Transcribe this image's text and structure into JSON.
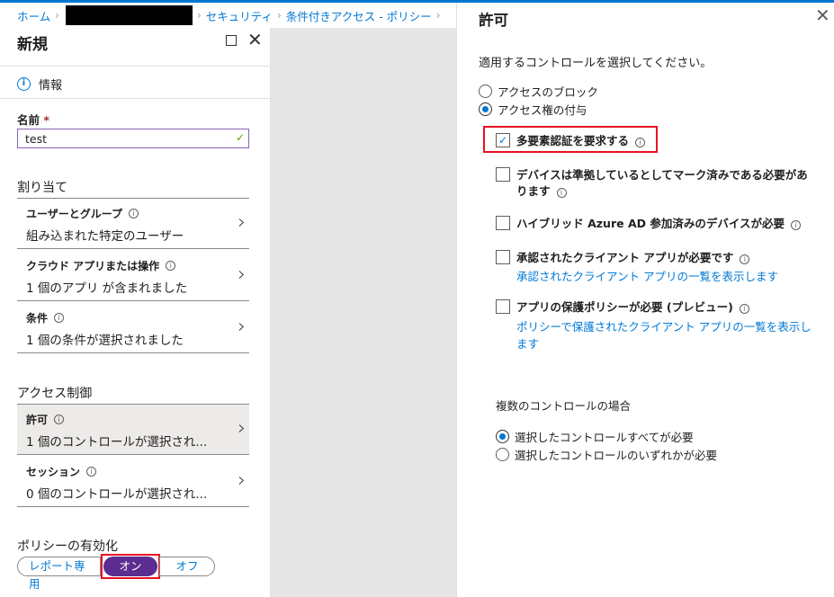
{
  "breadcrumb": {
    "home": "ホーム",
    "security": "セキュリティ",
    "policy": "条件付きアクセス - ポリシー"
  },
  "left": {
    "title": "新規",
    "info_label": "情報",
    "name_label": "名前",
    "required_mark": "*",
    "name_value": "test",
    "assignments_header": "割り当て",
    "assignments": [
      {
        "label": "ユーザーとグループ",
        "value": "組み込まれた特定のユーザー"
      },
      {
        "label": "クラウド アプリまたは操作",
        "value": "1 個のアプリ が含まれました"
      },
      {
        "label": "条件",
        "value": "1 個の条件が選択されました"
      }
    ],
    "access_header": "アクセス制御",
    "access": [
      {
        "label": "許可",
        "value": "1 個のコントロールが選択され..."
      },
      {
        "label": "セッション",
        "value": "0 個のコントロールが選択され..."
      }
    ],
    "enable_header": "ポリシーの有効化",
    "toggle": {
      "report": "レポート専用",
      "on": "オン",
      "off": "オフ"
    }
  },
  "right": {
    "title": "許可",
    "instruction": "適用するコントロールを選択してください。",
    "block_label": "アクセスのブロック",
    "grant_label": "アクセス権の付与",
    "controls": [
      {
        "label": "多要素認証を要求する",
        "checked": true
      },
      {
        "label": "デバイスは準拠しているとしてマーク済みである必要があります",
        "checked": false
      },
      {
        "label": "ハイブリッド Azure AD 参加済みのデバイスが必要",
        "checked": false
      },
      {
        "label": "承認されたクライアント アプリが必要です",
        "link": "承認されたクライアント アプリの一覧を表示します",
        "checked": false
      },
      {
        "label": "アプリの保護ポリシーが必要 (プレビュー)",
        "link": "ポリシーで保護されたクライアント アプリの一覧を表示します",
        "checked": false
      }
    ],
    "multi_header": "複数のコントロールの場合",
    "require_all": "選択したコントロールすべてが必要",
    "require_one": "選択したコントロールのいずれかが必要"
  },
  "colors": {
    "accent": "#0078d4",
    "toggle_on": "#5c2d91",
    "highlight": "#e81123"
  }
}
